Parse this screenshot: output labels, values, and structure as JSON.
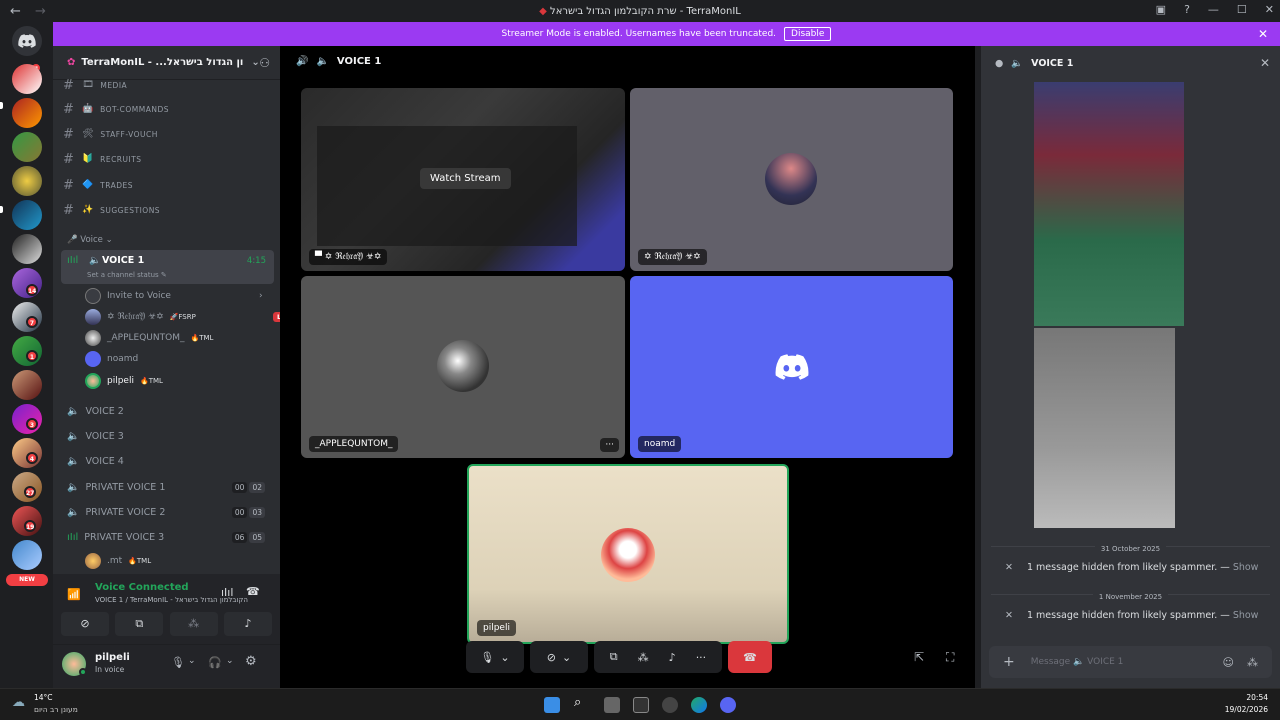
{
  "window": {
    "title": "שרת הקובלמון הגדול בישראל - TerraMonIL",
    "back": "←",
    "forward": "→"
  },
  "banner": {
    "text": "Streamer Mode is enabled. Usernames have been truncated.",
    "button": "Disable",
    "close": "✕"
  },
  "servers": {
    "badges": [
      "7",
      "14",
      "7",
      "1",
      "3",
      "4",
      "27",
      "19"
    ],
    "new_label": "NEW"
  },
  "sidebar": {
    "server_name": "TerraMonIL - ...ון הגדול בישראל",
    "channels": [
      {
        "name": "MEDIA",
        "emoji": "🎞"
      },
      {
        "name": "BOT-COMMANDS",
        "emoji": "🤖"
      },
      {
        "name": "STAFF-VOUCH",
        "emoji": "🛠"
      },
      {
        "name": "RECRUITS",
        "emoji": "🔰"
      },
      {
        "name": "TRADES",
        "emoji": "🔷"
      },
      {
        "name": "SUGGESTIONS",
        "emoji": "✨"
      }
    ],
    "voice_category": "Voice",
    "active_voice": {
      "name": "VOICE 1",
      "time": "4:15",
      "status_hint": "Set a channel status"
    },
    "invite_label": "Invite to Voice",
    "members": [
      {
        "name": "✡ ℜ𝔢𝔥𝔯𝔞𝔜 ☣✡",
        "tag": "FSRP",
        "live": "LIVE"
      },
      {
        "name": "_APPLEQUNTOM_",
        "tag": "TML"
      },
      {
        "name": "noamd",
        "tag": ""
      },
      {
        "name": "pilpeli",
        "tag": "TML"
      }
    ],
    "voice_channels": [
      {
        "name": "VOICE 2"
      },
      {
        "name": "VOICE 3"
      },
      {
        "name": "VOICE 4"
      },
      {
        "name": "PRIVATE VOICE 1",
        "c1": "00",
        "c2": "02"
      },
      {
        "name": "PRIVATE VOICE 2",
        "c1": "00",
        "c2": "03"
      },
      {
        "name": "PRIVATE VOICE 3",
        "c1": "06",
        "c2": "05"
      }
    ],
    "sub_member": {
      "name": ".mt",
      "tag": "TML"
    }
  },
  "voice_panel": {
    "status": "Voice Connected",
    "location": "VOICE 1 / TerraMonIL - שרת הקובלמון הגדול בישראל"
  },
  "user": {
    "name": "pilpeli",
    "status": "In voice"
  },
  "main": {
    "channel": "VOICE 1",
    "watch_stream": "Watch Stream",
    "tiles": [
      {
        "label": "✡ ℜ𝔢𝔥𝔯𝔞𝔜 ☣✡"
      },
      {
        "label": "✡ ℜ𝔢𝔥𝔯𝔞𝔜 ☣✡"
      },
      {
        "label": "_APPLEQUNTOM_"
      },
      {
        "label": "noamd"
      },
      {
        "label": "pilpeli"
      }
    ],
    "more": "···"
  },
  "chat": {
    "title": "VOICE 1",
    "dates": [
      "31 October 2025",
      "1 November 2025"
    ],
    "hidden_msg": "1 message hidden from likely spammer. —",
    "show": "Show",
    "placeholder": "Message 🔈 VOICE 1"
  },
  "taskbar": {
    "temp": "14°C",
    "weather": "מעונן רב היום",
    "time": "20:54",
    "date": "19/02/2026"
  },
  "colors": {
    "accent": "#5865f2",
    "banner": "#9b3af2",
    "green": "#23a55a",
    "red": "#da373c"
  }
}
